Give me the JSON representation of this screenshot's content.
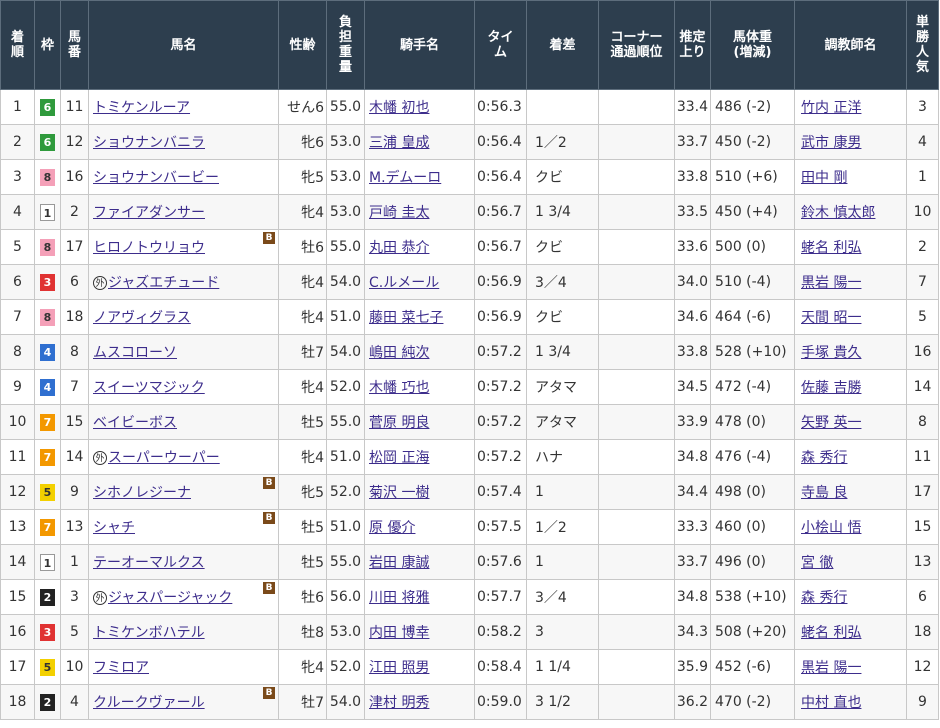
{
  "headers": {
    "rank": "着順",
    "waku": "枠",
    "umaban": "馬番",
    "name": "馬名",
    "sexage": "性齢",
    "weight": "負担重量",
    "jockey": "騎手名",
    "time": "タイム",
    "margin": "着差",
    "corner": "コーナー通過順位",
    "last3f": "推定上り",
    "bodyweight": "馬体重(増減)",
    "trainer": "調教師名",
    "popularity": "単勝人気"
  },
  "colors": {
    "header_bg": "#2d3e4e",
    "link": "#3d2d8c",
    "waku_1": "#ffffff",
    "waku_2": "#222222",
    "waku_3": "#e03232",
    "waku_4": "#2f6fd0",
    "waku_5": "#f3d000",
    "waku_6": "#2f9a3c",
    "waku_7": "#f39800",
    "waku_8": "#f4a0b8"
  },
  "rows": [
    {
      "rank": "1",
      "waku": "6",
      "umaban": "11",
      "maru": "",
      "name": "トミケンルーア",
      "blinker": "",
      "sexage": "せん6",
      "weight": "55.0",
      "jockey": "木幡 初也",
      "time": "0:56.3",
      "margin": "",
      "corner": "",
      "last3f": "33.4",
      "bodyweight": "486 (-2)",
      "trainer": "竹内 正洋",
      "popularity": "3"
    },
    {
      "rank": "2",
      "waku": "6",
      "umaban": "12",
      "maru": "",
      "name": "ショウナンバニラ",
      "blinker": "",
      "sexage": "牝6",
      "weight": "53.0",
      "jockey": "三浦 皇成",
      "time": "0:56.4",
      "margin": "1／2",
      "corner": "",
      "last3f": "33.7",
      "bodyweight": "450 (-2)",
      "trainer": "武市 康男",
      "popularity": "4"
    },
    {
      "rank": "3",
      "waku": "8",
      "umaban": "16",
      "maru": "",
      "name": "ショウナンバービー",
      "blinker": "",
      "sexage": "牝5",
      "weight": "53.0",
      "jockey": "M.デムーロ",
      "time": "0:56.4",
      "margin": "クビ",
      "corner": "",
      "last3f": "33.8",
      "bodyweight": "510 (+6)",
      "trainer": "田中 剛",
      "popularity": "1"
    },
    {
      "rank": "4",
      "waku": "1",
      "umaban": "2",
      "maru": "",
      "name": "ファイアダンサー",
      "blinker": "",
      "sexage": "牝4",
      "weight": "53.0",
      "jockey": "戸崎 圭太",
      "time": "0:56.7",
      "margin": "1 3/4",
      "corner": "",
      "last3f": "33.5",
      "bodyweight": "450 (+4)",
      "trainer": "鈴木 慎太郎",
      "popularity": "10"
    },
    {
      "rank": "5",
      "waku": "8",
      "umaban": "17",
      "maru": "",
      "name": "ヒロノトウリョウ",
      "blinker": "B",
      "sexage": "牡6",
      "weight": "55.0",
      "jockey": "丸田 恭介",
      "time": "0:56.7",
      "margin": "クビ",
      "corner": "",
      "last3f": "33.6",
      "bodyweight": "500 (0)",
      "trainer": "蛯名 利弘",
      "popularity": "2"
    },
    {
      "rank": "6",
      "waku": "3",
      "umaban": "6",
      "maru": "外",
      "name": "ジャズエチュード",
      "blinker": "",
      "sexage": "牝4",
      "weight": "54.0",
      "jockey": "C.ルメール",
      "time": "0:56.9",
      "margin": "3／4",
      "corner": "",
      "last3f": "34.0",
      "bodyweight": "510 (-4)",
      "trainer": "黒岩 陽一",
      "popularity": "7"
    },
    {
      "rank": "7",
      "waku": "8",
      "umaban": "18",
      "maru": "",
      "name": "ノアヴィグラス",
      "blinker": "",
      "sexage": "牝4",
      "weight": "51.0",
      "jockey": "藤田 菜七子",
      "time": "0:56.9",
      "margin": "クビ",
      "corner": "",
      "last3f": "34.6",
      "bodyweight": "464 (-6)",
      "trainer": "天間 昭一",
      "popularity": "5"
    },
    {
      "rank": "8",
      "waku": "4",
      "umaban": "8",
      "maru": "",
      "name": "ムスコローソ",
      "blinker": "",
      "sexage": "牡7",
      "weight": "54.0",
      "jockey": "嶋田 純次",
      "time": "0:57.2",
      "margin": "1 3/4",
      "corner": "",
      "last3f": "33.8",
      "bodyweight": "528 (+10)",
      "trainer": "手塚 貴久",
      "popularity": "16"
    },
    {
      "rank": "9",
      "waku": "4",
      "umaban": "7",
      "maru": "",
      "name": "スイーツマジック",
      "blinker": "",
      "sexage": "牝4",
      "weight": "52.0",
      "jockey": "木幡 巧也",
      "time": "0:57.2",
      "margin": "アタマ",
      "corner": "",
      "last3f": "34.5",
      "bodyweight": "472 (-4)",
      "trainer": "佐藤 吉勝",
      "popularity": "14"
    },
    {
      "rank": "10",
      "waku": "7",
      "umaban": "15",
      "maru": "",
      "name": "ベイビーボス",
      "blinker": "",
      "sexage": "牡5",
      "weight": "55.0",
      "jockey": "菅原 明良",
      "time": "0:57.2",
      "margin": "アタマ",
      "corner": "",
      "last3f": "33.9",
      "bodyweight": "478 (0)",
      "trainer": "矢野 英一",
      "popularity": "8"
    },
    {
      "rank": "11",
      "waku": "7",
      "umaban": "14",
      "maru": "外",
      "name": "スーパーウーパー",
      "blinker": "",
      "sexage": "牝4",
      "weight": "51.0",
      "jockey": "松岡 正海",
      "time": "0:57.2",
      "margin": "ハナ",
      "corner": "",
      "last3f": "34.8",
      "bodyweight": "476 (-4)",
      "trainer": "森 秀行",
      "popularity": "11"
    },
    {
      "rank": "12",
      "waku": "5",
      "umaban": "9",
      "maru": "",
      "name": "シホノレジーナ",
      "blinker": "B",
      "sexage": "牝5",
      "weight": "52.0",
      "jockey": "菊沢 一樹",
      "time": "0:57.4",
      "margin": "1",
      "corner": "",
      "last3f": "34.4",
      "bodyweight": "498 (0)",
      "trainer": "寺島 良",
      "popularity": "17"
    },
    {
      "rank": "13",
      "waku": "7",
      "umaban": "13",
      "maru": "",
      "name": "シャチ",
      "blinker": "B",
      "sexage": "牡5",
      "weight": "51.0",
      "jockey": "原 優介",
      "time": "0:57.5",
      "margin": "1／2",
      "corner": "",
      "last3f": "33.3",
      "bodyweight": "460 (0)",
      "trainer": "小桧山 悟",
      "popularity": "15"
    },
    {
      "rank": "14",
      "waku": "1",
      "umaban": "1",
      "maru": "",
      "name": "テーオーマルクス",
      "blinker": "",
      "sexage": "牡5",
      "weight": "55.0",
      "jockey": "岩田 康誠",
      "time": "0:57.6",
      "margin": "1",
      "corner": "",
      "last3f": "33.7",
      "bodyweight": "496 (0)",
      "trainer": "宮 徹",
      "popularity": "13"
    },
    {
      "rank": "15",
      "waku": "2",
      "umaban": "3",
      "maru": "外",
      "name": "ジャスパージャック",
      "blinker": "B",
      "sexage": "牡6",
      "weight": "56.0",
      "jockey": "川田 将雅",
      "time": "0:57.7",
      "margin": "3／4",
      "corner": "",
      "last3f": "34.8",
      "bodyweight": "538 (+10)",
      "trainer": "森 秀行",
      "popularity": "6"
    },
    {
      "rank": "16",
      "waku": "3",
      "umaban": "5",
      "maru": "",
      "name": "トミケンボハテル",
      "blinker": "",
      "sexage": "牡8",
      "weight": "53.0",
      "jockey": "内田 博幸",
      "time": "0:58.2",
      "margin": "3",
      "corner": "",
      "last3f": "34.3",
      "bodyweight": "508 (+20)",
      "trainer": "蛯名 利弘",
      "popularity": "18"
    },
    {
      "rank": "17",
      "waku": "5",
      "umaban": "10",
      "maru": "",
      "name": "フミロア",
      "blinker": "",
      "sexage": "牝4",
      "weight": "52.0",
      "jockey": "江田 照男",
      "time": "0:58.4",
      "margin": "1 1/4",
      "corner": "",
      "last3f": "35.9",
      "bodyweight": "452 (-6)",
      "trainer": "黒岩 陽一",
      "popularity": "12"
    },
    {
      "rank": "18",
      "waku": "2",
      "umaban": "4",
      "maru": "",
      "name": "クルークヴァール",
      "blinker": "B",
      "sexage": "牡7",
      "weight": "54.0",
      "jockey": "津村 明秀",
      "time": "0:59.0",
      "margin": "3 1/2",
      "corner": "",
      "last3f": "36.2",
      "bodyweight": "470 (-2)",
      "trainer": "中村 直也",
      "popularity": "9"
    }
  ]
}
